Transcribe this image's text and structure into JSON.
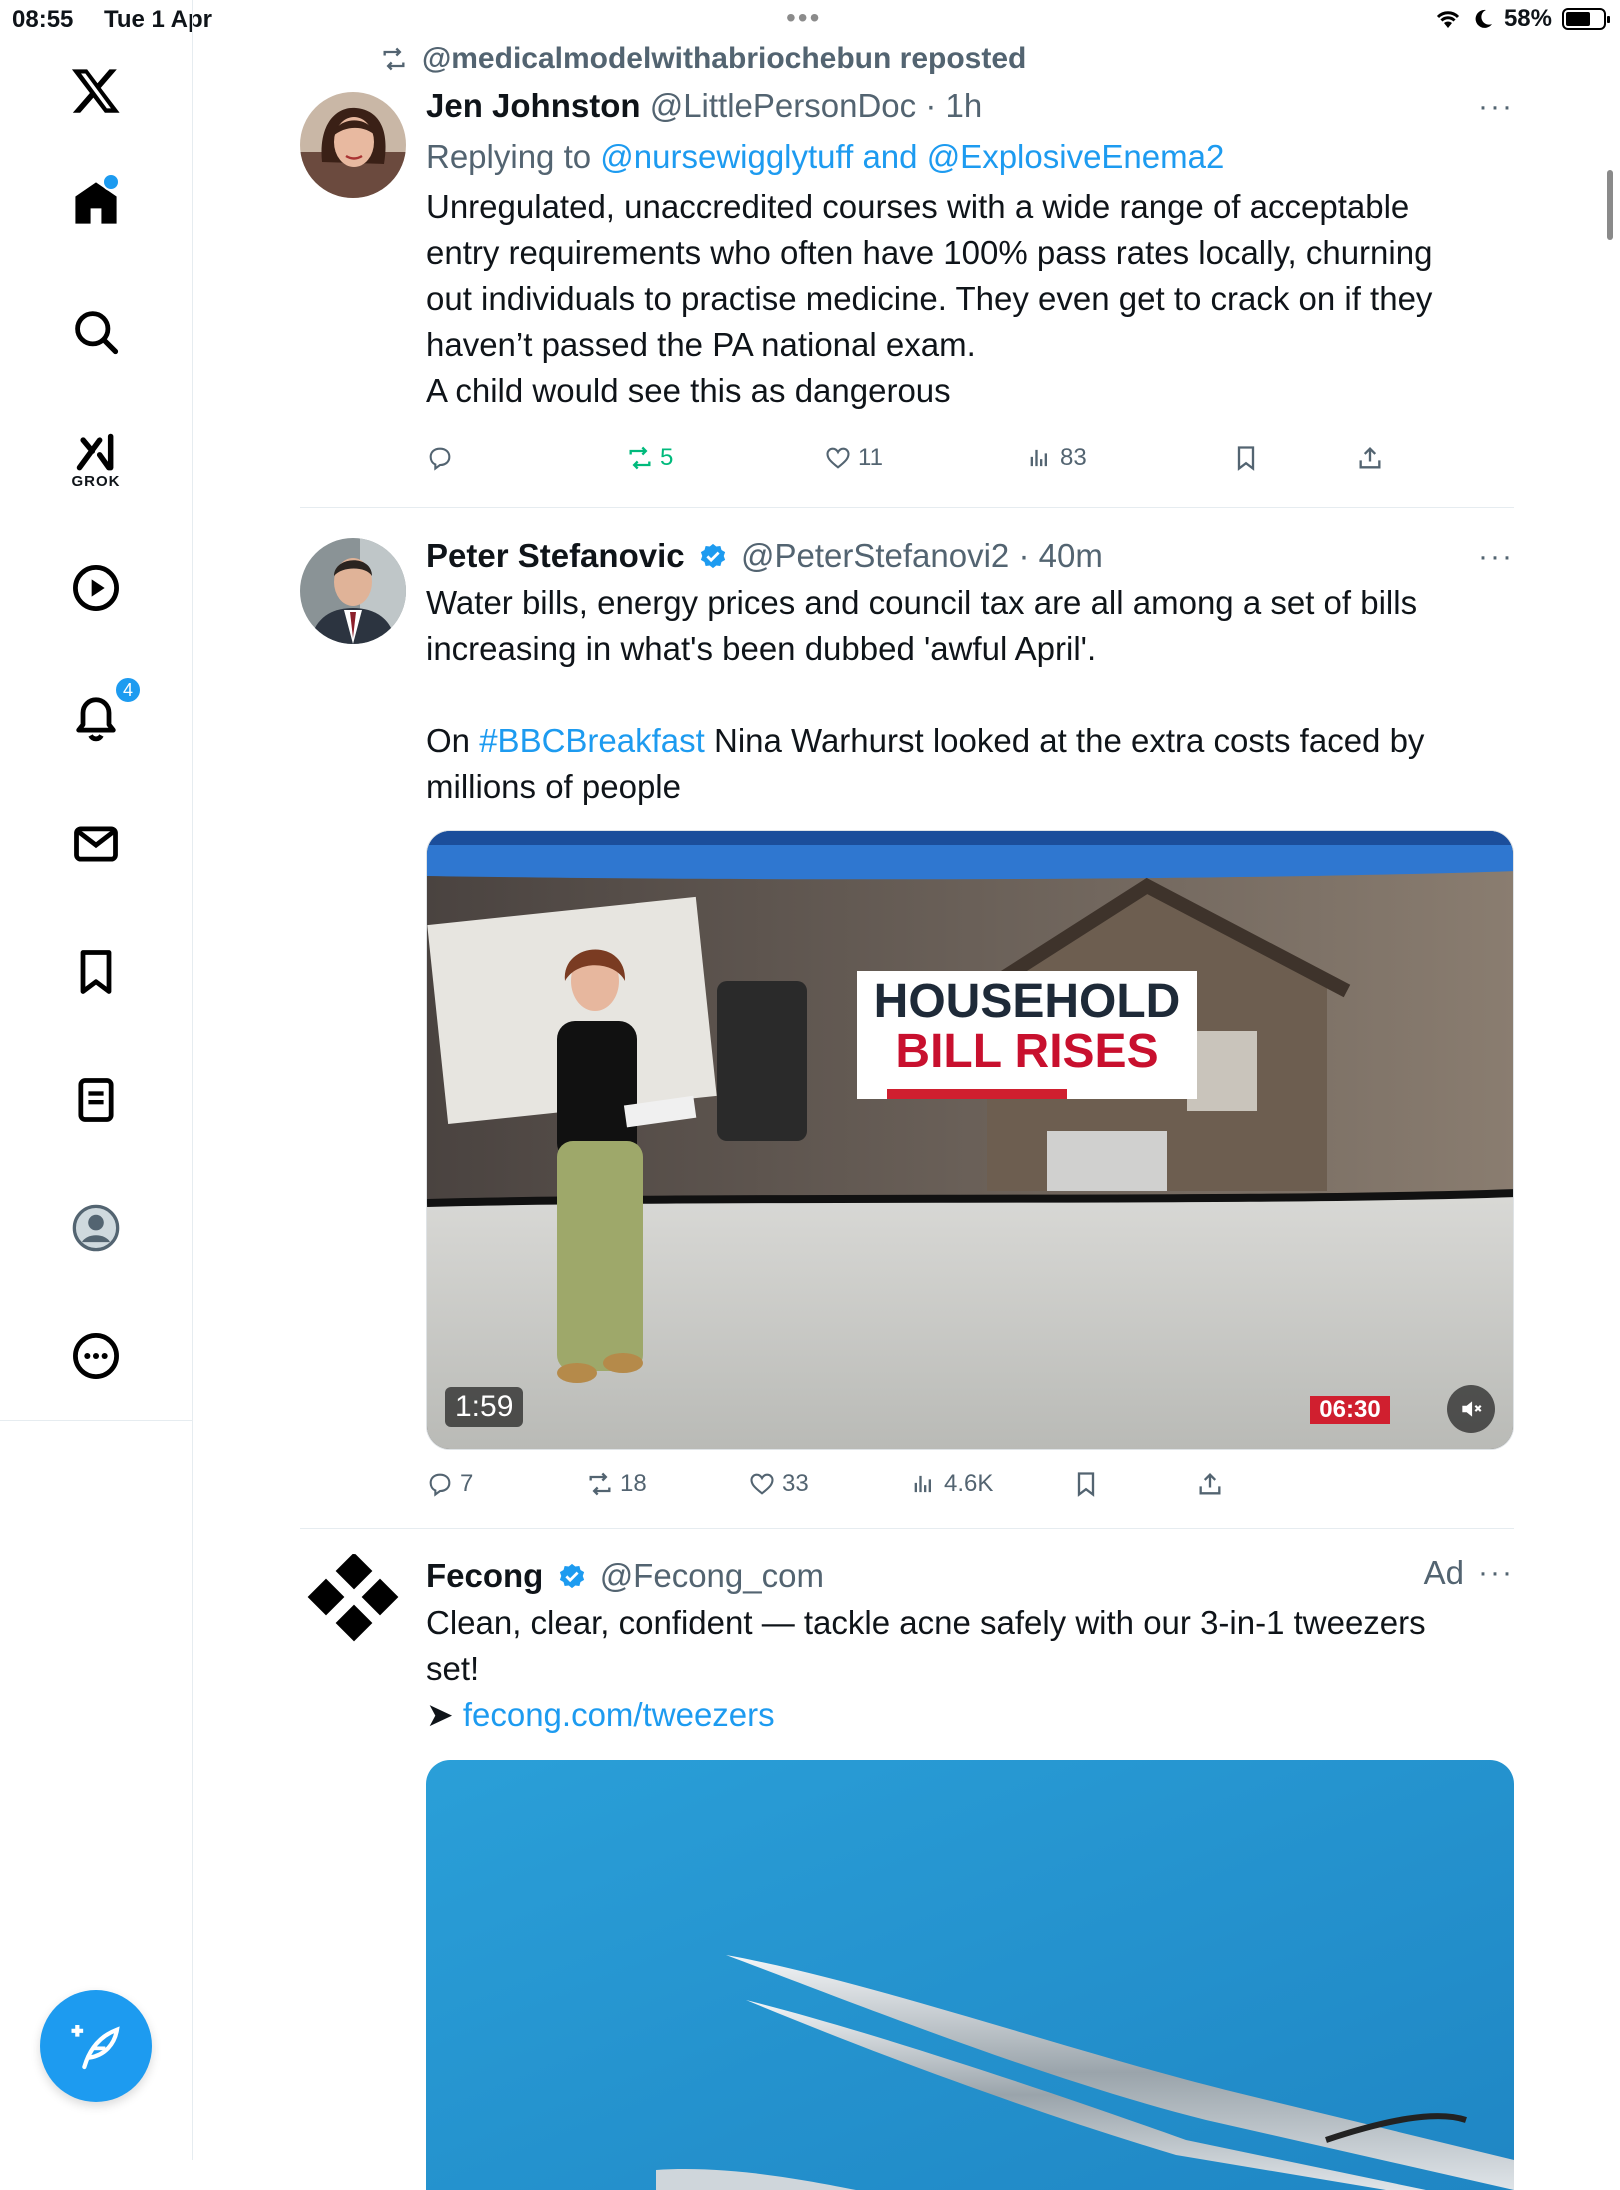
{
  "status_bar": {
    "time": "08:55",
    "date": "Tue 1 Apr",
    "battery": "58%",
    "dots": "•••"
  },
  "sidebar": {
    "items": [
      {
        "icon": "x-logo-icon"
      },
      {
        "icon": "home-icon",
        "has_dot": true
      },
      {
        "icon": "search-icon"
      },
      {
        "icon": "grok-icon",
        "label": "GROK"
      },
      {
        "icon": "video-play-icon"
      },
      {
        "icon": "bell-icon",
        "badge": "4"
      },
      {
        "icon": "mail-icon"
      },
      {
        "icon": "bookmark-icon"
      },
      {
        "icon": "list-icon"
      },
      {
        "icon": "profile-icon"
      },
      {
        "icon": "more-icon"
      }
    ],
    "compose_icon": "compose-feather-icon"
  },
  "posts": [
    {
      "repost_label": "@medicalmodelwithabriochebun reposted",
      "name": "Jen Johnston",
      "handle": "@LittlePersonDoc",
      "time": "· 1h",
      "replying_prefix": "Replying to ",
      "replying_user1": "@nursewigglytuff",
      "replying_and": " and ",
      "replying_user2": "@ExplosiveEnema2",
      "text_lines": [
        "Unregulated, unaccredited courses with  a wide range of acceptable",
        "entry requirements who often have 100% pass rates locally, churning",
        "out individuals to practise medicine. They even get to crack on if they",
        "haven’t passed the PA national exam.",
        "A child would see this as dangerous"
      ],
      "stats": {
        "replies": "",
        "reposts": "5",
        "likes": "11",
        "views": "83"
      },
      "reposted_active": true
    },
    {
      "name": "Peter Stefanovic",
      "verified": true,
      "handle": "@PeterStefanovi2",
      "time": "· 40m",
      "text_line1": "Water bills, energy prices and council tax are all among a set of bills",
      "text_line2": "increasing in what's been dubbed 'awful April'.",
      "text_line3_pre": "On ",
      "hashtag": "#BBCBreakfast",
      "text_line3_post": " Nina Warhurst looked at the extra costs faced by",
      "text_line4": "millions of people",
      "video": {
        "headline_line1": "HOUSEHOLD",
        "headline_line2": "BILL RISES",
        "duration": "1:59",
        "clock": "06:30",
        "mute_icon": "muted-speaker-icon"
      },
      "stats": {
        "replies": "7",
        "reposts": "18",
        "likes": "33",
        "views": "4.6K"
      }
    },
    {
      "name": "Fecong",
      "verified": true,
      "handle": "@Fecong_com",
      "ad_label": "Ad",
      "text_line1": "Clean, clear, confident — tackle acne safely with our 3-in-1 tweezers",
      "text_line2": "set!",
      "arrow": "➤ ",
      "link": "fecong.com/tweezers",
      "more": "···"
    }
  ],
  "colors": {
    "accent": "#1d9bf0",
    "repost_green": "#00ba7c",
    "text": "#0f1419",
    "muted": "#536471"
  }
}
